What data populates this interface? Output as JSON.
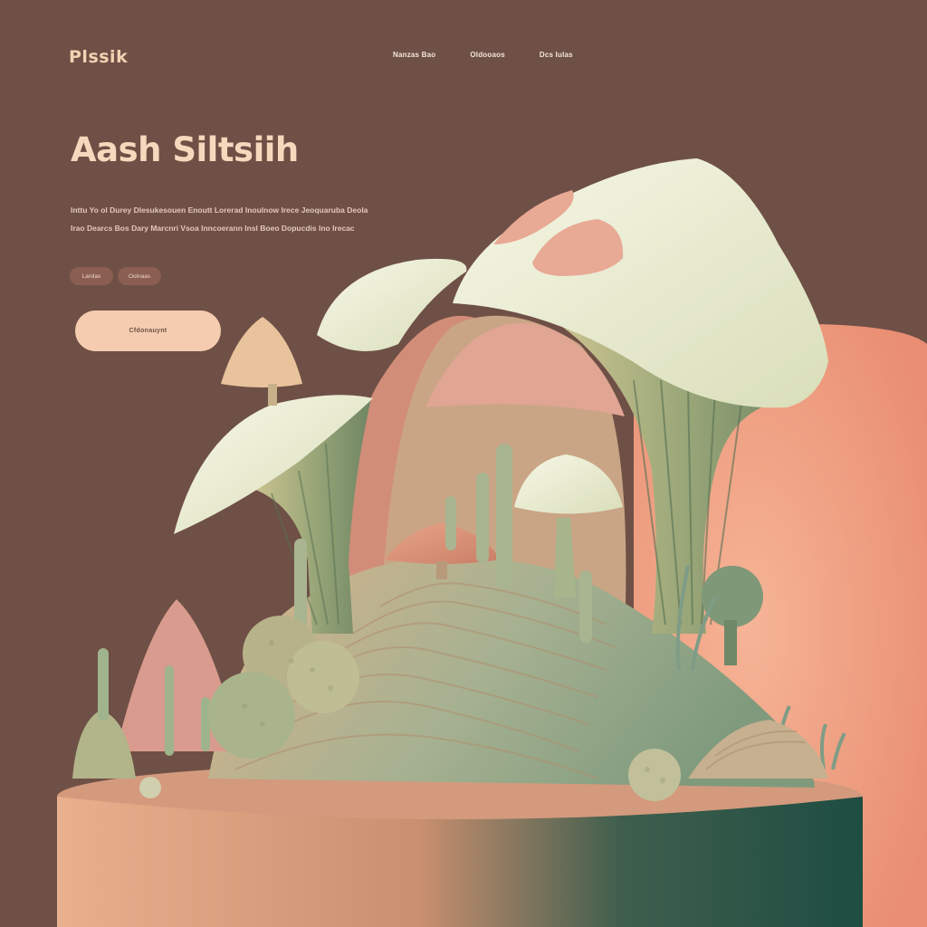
{
  "brand": {
    "logo": "Plssik"
  },
  "nav": {
    "items": [
      "Nanzas Bao",
      "Oldooaos",
      "Dcs Iulas"
    ]
  },
  "hero": {
    "title": "Aash Siltsiih",
    "description": "Inttu Yo ol Durey Dlesukesouen Enoutt Lorerad Inoulnow Irece Jeoquaruba Deola Irao Dearcs Bos Dary Marcnri Vsoa Inncoerann Insl Boeo Dopucdis Ino Irecac",
    "tags": [
      "Lanilas",
      "Oolnaas"
    ],
    "cta_label": "Cfdonauynt"
  },
  "colors": {
    "background": "#6f5046",
    "accent": "#f5ccb0",
    "sun": "#f0a586",
    "mint": "#a8b58f",
    "cream": "#eef1dc"
  }
}
